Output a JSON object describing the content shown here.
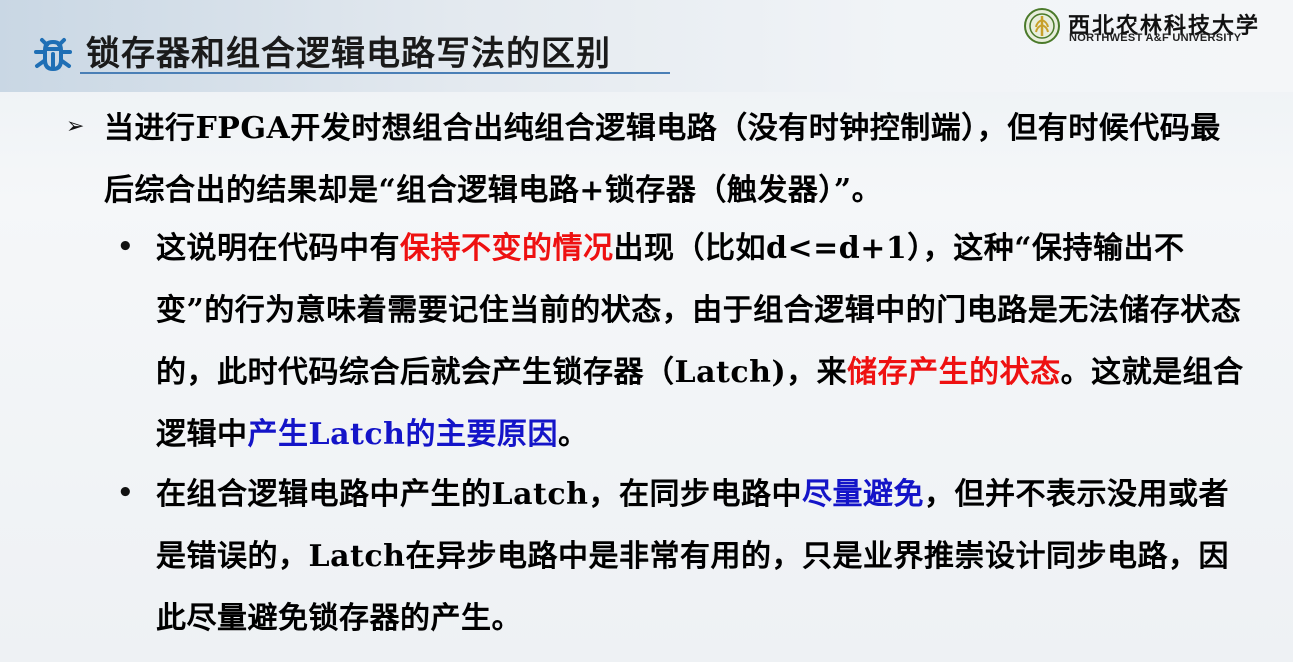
{
  "header": {
    "title": "锁存器和组合逻辑电路写法的区别",
    "title_icon": "bug-icon",
    "accent_color": "#1f6fb5"
  },
  "logo": {
    "name_cn": "西北农林科技大学",
    "name_en": "NORTHWEST A&F UNIVERSITY",
    "seal_color": "#4b7a2a"
  },
  "content": {
    "level1": {
      "marker": "➢",
      "text": "当进行FPGA开发时想组合出纯组合逻辑电路（没有时钟控制端），但有时候代码最后综合出的结果却是“组合逻辑电路+锁存器（触发器）”。"
    },
    "bullet1": {
      "marker": "•",
      "seg1": "这说明在代码中有",
      "seg2_red": "保持不变的情况",
      "seg3": "出现（比如d<=d+1），这种“保持输出不变”的行为意味着需要记住当前的状态，由于组合逻辑中的门电路是无法储存状态的，此时代码综合后就会产生锁存器（Latch)，来",
      "seg4_red": "储存产生的状态",
      "seg5": "。这就是组合逻辑中",
      "seg6_blue": "产生Latch的主要原因",
      "seg7": "。"
    },
    "bullet2": {
      "marker": "•",
      "seg1": "在组合逻辑电路中产生的Latch，在同步电路中",
      "seg2_blue": "尽量避免",
      "seg3": "，但并不表示没用或者是错误的，Latch在异步电路中是非常有用的，只是业界推崇设计同步电路，因此尽量避免锁存器的产生。"
    },
    "colors": {
      "red": "#ee1111",
      "blue": "#1414c8"
    }
  }
}
